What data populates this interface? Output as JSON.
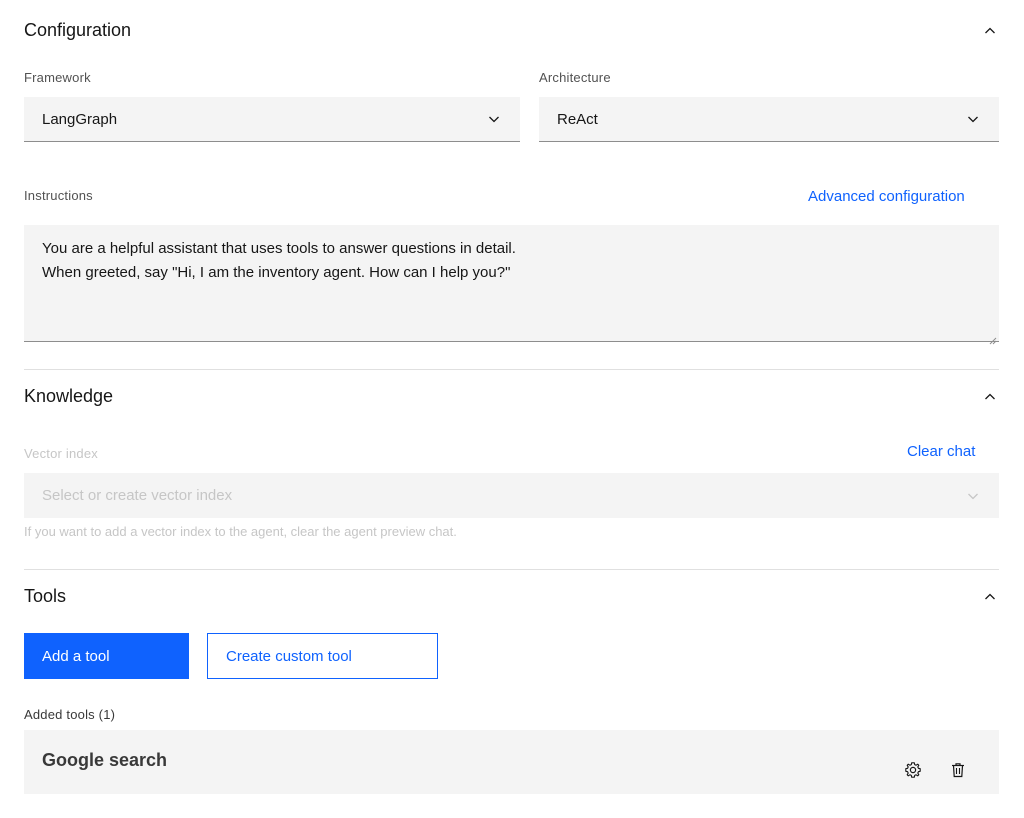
{
  "configuration": {
    "title": "Configuration",
    "framework": {
      "label": "Framework",
      "value": "LangGraph"
    },
    "architecture": {
      "label": "Architecture",
      "value": "ReAct"
    },
    "instructions": {
      "label": "Instructions",
      "advanced_link": "Advanced configuration",
      "lines": [
        "You are a helpful assistant that uses tools to answer questions in detail.",
        "When greeted, say \"Hi, I am the inventory agent. How can I help you?\""
      ]
    }
  },
  "knowledge": {
    "title": "Knowledge",
    "vector_index": {
      "label": "Vector index",
      "clear_link": "Clear chat",
      "placeholder": "Select or create vector index",
      "helper": "If you want to add a vector index to the agent, clear the agent preview chat."
    }
  },
  "tools": {
    "title": "Tools",
    "add_button": "Add a tool",
    "create_button": "Create custom tool",
    "added_label": "Added tools (1)",
    "items": [
      {
        "name": "Google search"
      }
    ]
  },
  "colors": {
    "accent": "#0f62fe",
    "field_bg": "#f4f4f4",
    "text": "#161616",
    "muted": "#525252",
    "disabled": "#c6c6c6"
  },
  "icons": {
    "collapse": "chevron-up-icon",
    "dropdown": "chevron-down-icon",
    "settings": "gear-icon",
    "delete": "trash-icon"
  }
}
